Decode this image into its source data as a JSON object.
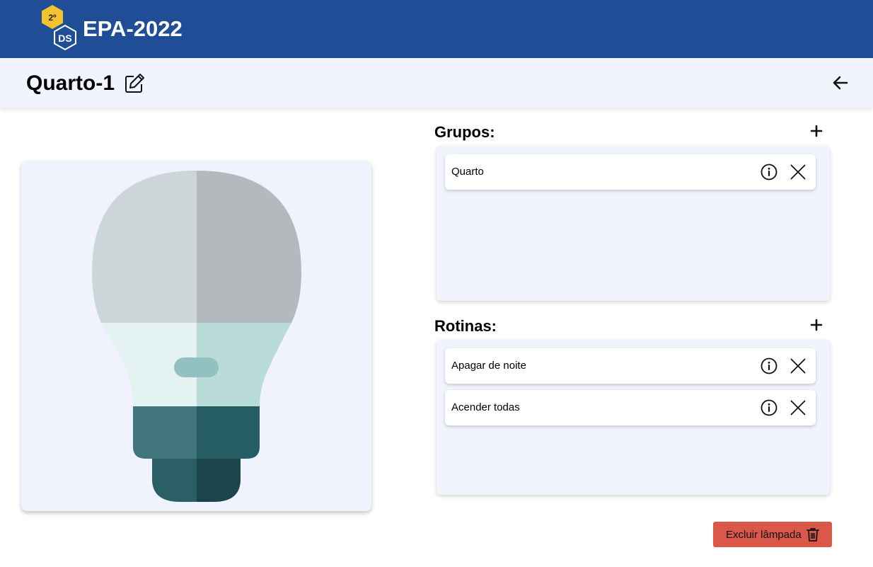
{
  "header": {
    "logo_badge": "2º",
    "logo_mark": "DS",
    "app_title": "EPA-2022"
  },
  "subheader": {
    "device_name": "Quarto-1",
    "edit_icon": "pencil-square-icon",
    "back_icon": "arrow-left-icon"
  },
  "device_image": {
    "icon": "light-bulb"
  },
  "groups": {
    "title": "Grupos:",
    "add_icon": "plus-icon",
    "items": [
      {
        "label": "Quarto"
      }
    ]
  },
  "routines": {
    "title": "Rotinas:",
    "add_icon": "plus-icon",
    "items": [
      {
        "label": "Apagar de noite"
      },
      {
        "label": "Acender todas"
      }
    ]
  },
  "actions": {
    "delete_label": "Excluir lâmpada",
    "delete_icon": "trash-icon"
  },
  "colors": {
    "header_bg": "#1f4e96",
    "subheader_bg": "#f1f3fd",
    "panel_bg": "#f1f3fd",
    "delete_bg": "#d9584a",
    "logo_yellow": "#f2c230"
  }
}
